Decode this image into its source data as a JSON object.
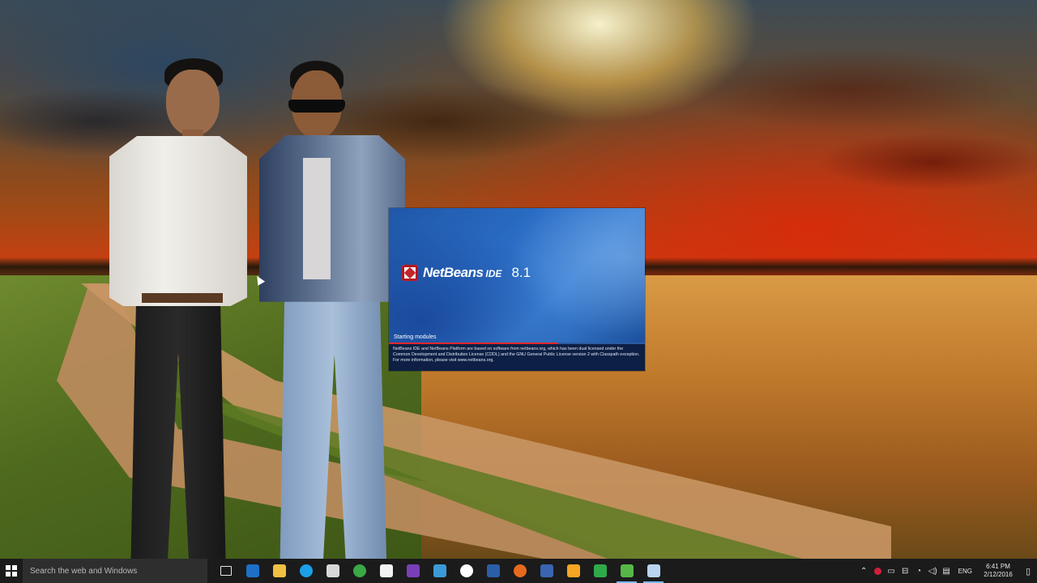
{
  "splash": {
    "product": "NetBeans",
    "product_suffix": "IDE",
    "version": "8.1",
    "status": "Starting modules",
    "progress_percent": 66,
    "license": "NetBeans IDE and NetBeans Platform are based on software from netbeans.org, which has been dual licensed under the Common Development and Distribution License (CDDL) and the GNU General Public License version 2 with Classpath exception. For more information, please visit www.netbeans.org."
  },
  "taskbar": {
    "search_placeholder": "Search the web and Windows",
    "apps": [
      {
        "icon": "task-view-icon",
        "color": "#1b1b1b"
      },
      {
        "icon": "edge-icon",
        "color": "#1e6fc8"
      },
      {
        "icon": "file-explorer-icon",
        "color": "#f0c040"
      },
      {
        "icon": "skype-icon",
        "color": "#1aa0e8"
      },
      {
        "icon": "app-icon",
        "color": "#d8d8d8"
      },
      {
        "icon": "chrome-icon",
        "color": "#3aa845"
      },
      {
        "icon": "document-icon",
        "color": "#f2f2f2"
      },
      {
        "icon": "visual-studio-icon",
        "color": "#7a3fb8"
      },
      {
        "icon": "app-icon",
        "color": "#3a9ad8"
      },
      {
        "icon": "shield-icon",
        "color": "#ffffff"
      },
      {
        "icon": "word-icon",
        "color": "#2b5ea8"
      },
      {
        "icon": "firefox-icon",
        "color": "#e66a1e"
      },
      {
        "icon": "visio-icon",
        "color": "#3a64b0"
      },
      {
        "icon": "app-icon",
        "color": "#f5a623"
      },
      {
        "icon": "app-icon",
        "color": "#2faa4a"
      },
      {
        "icon": "app-icon",
        "color": "#57b848"
      },
      {
        "icon": "netbeans-icon",
        "color": "#b8d4f0"
      }
    ],
    "active_indices": [
      15,
      16
    ],
    "language": "ENG",
    "time": "6:41 PM",
    "date": "2/12/2016"
  }
}
